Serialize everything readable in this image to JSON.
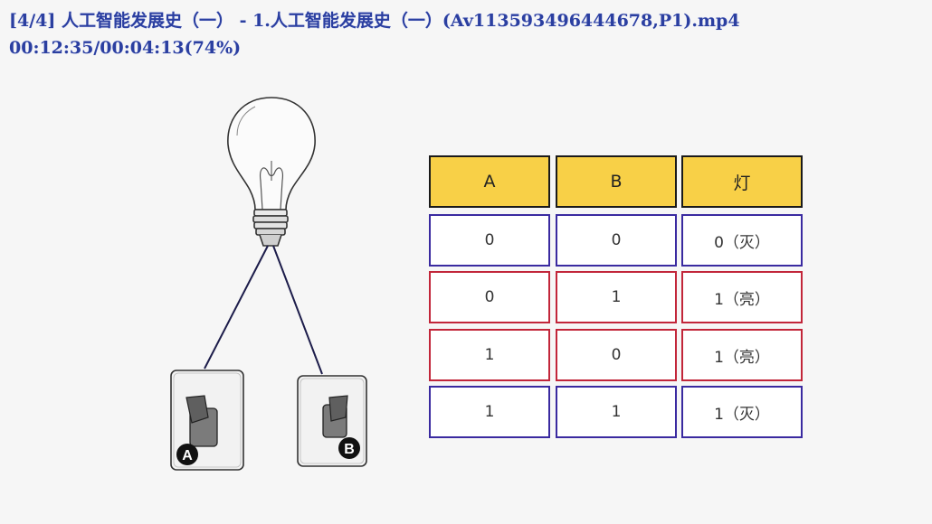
{
  "overlay": {
    "title_line": "[4/4] 人工智能发展史（一） - 1.人工智能发展史（一）(Av113593496444678,P1).mp4",
    "time_line": "00:12:35/00:04:13(74%)"
  },
  "switches": {
    "a_label": "A",
    "b_label": "B"
  },
  "table": {
    "headers": [
      "A",
      "B",
      "灯"
    ],
    "rows": [
      {
        "a": "0",
        "b": "0",
        "lamp": "0（灭）",
        "border": "blue"
      },
      {
        "a": "0",
        "b": "1",
        "lamp": "1（亮）",
        "border": "red"
      },
      {
        "a": "1",
        "b": "0",
        "lamp": "1（亮）",
        "border": "red"
      },
      {
        "a": "1",
        "b": "1",
        "lamp": "1（灭）",
        "border": "blue"
      }
    ]
  },
  "colors": {
    "header_fill": "#f8d047",
    "border_blue": "#3a2aa0",
    "border_red": "#c2263a",
    "overlay_text": "#2b3fa0"
  }
}
